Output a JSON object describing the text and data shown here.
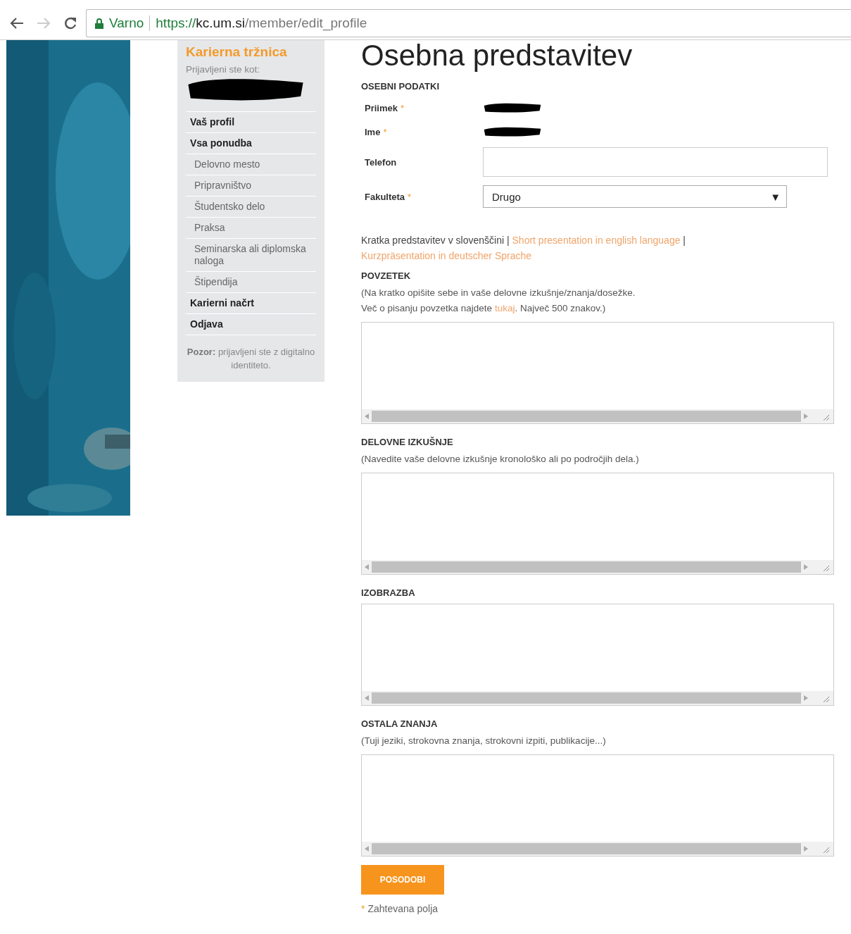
{
  "browser": {
    "secure_label": "Varno",
    "url_scheme": "https://",
    "url_host": "kc.um.si",
    "url_path": "/member/edit_profile"
  },
  "sidebar": {
    "title": "Karierna tržnica",
    "logged_in_label": "Prijavljeni ste kot:",
    "items": [
      {
        "label": "Vaš profil",
        "kind": "main"
      },
      {
        "label": "Vsa ponudba",
        "kind": "main"
      },
      {
        "label": "Delovno mesto",
        "kind": "sub"
      },
      {
        "label": "Pripravništvo",
        "kind": "sub"
      },
      {
        "label": "Študentsko delo",
        "kind": "sub"
      },
      {
        "label": "Praksa",
        "kind": "sub"
      },
      {
        "label": "Seminarska ali diplomska naloga",
        "kind": "sub"
      },
      {
        "label": "Štipendija",
        "kind": "sub"
      },
      {
        "label": "Karierni načrt",
        "kind": "main"
      },
      {
        "label": "Odjava",
        "kind": "main"
      }
    ],
    "notice": "**Pozor:** prijavljeni ste z digitalno identiteto."
  },
  "main": {
    "title": "Osebna predstavitev",
    "section": "OSEBNI PODATKI",
    "fields": [
      {
        "label": "Priimek",
        "required_mark": "*",
        "kind": "static"
      },
      {
        "label": "Ime",
        "required_mark": "*",
        "kind": "static"
      },
      {
        "label": "Telefon",
        "kind": "text"
      },
      {
        "label": "Fakulteta",
        "required_mark": "*",
        "kind": "select",
        "value": "Drugo",
        "arrow": "▼"
      }
    ],
    "language_line": [
      {
        "kind": "text",
        "text": "Kratka predstavitev v slovenščini"
      },
      {
        "kind": "separator",
        "text": "|"
      },
      {
        "kind": "link",
        "text": "Short presentation in english language"
      },
      {
        "kind": "separator",
        "text": "|"
      },
      {
        "kind": "link",
        "text": "Kurzpräsentation in deutscher Sprache"
      }
    ],
    "text_sections": [
      {
        "heading": "POVZETEK",
        "hint_lines": [
          [
            {
              "kind": "text",
              "text": "(Na kratko opišite sebe in vaše delovne izkušnje/znanja/dosežke."
            }
          ],
          [
            {
              "kind": "text",
              "text": "Več o pisanju povzetka najdete "
            },
            {
              "kind": "link",
              "text": "tukaj"
            },
            {
              "kind": "text",
              "text": ". Največ 500 znakov.)"
            }
          ]
        ]
      },
      {
        "heading": "DELOVNE IZKUŠNJE",
        "hint_lines": [
          [
            {
              "kind": "text",
              "text": "(Navedite vaše delovne izkušnje kronološko ali po področjih dela.)"
            }
          ]
        ]
      },
      {
        "heading": "IZOBRAZBA"
      },
      {
        "heading": "OSTALA ZNANJA",
        "hint_lines": [
          [
            {
              "kind": "text",
              "text": "(Tuji jeziki, strokovna znanja, strokovni izpiti, publikacije...)"
            }
          ]
        ]
      }
    ],
    "submit": "POSODOBI",
    "footnote": {
      "mark": "*",
      "text": "Zahtevana polja"
    }
  }
}
